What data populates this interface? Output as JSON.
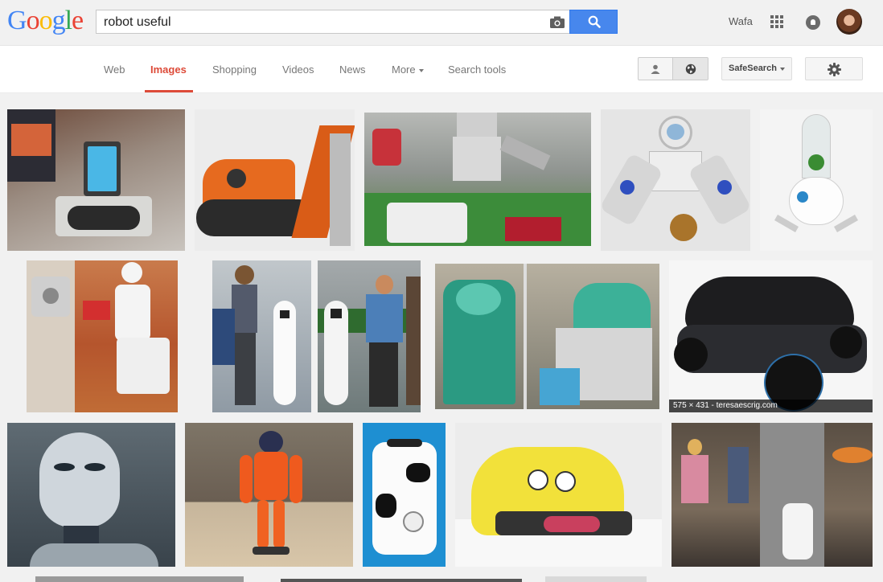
{
  "header": {
    "logo_letters": [
      "G",
      "o",
      "o",
      "g",
      "l",
      "e"
    ],
    "logo_colors": [
      "#4285f4",
      "#ea4335",
      "#fbbc05",
      "#4285f4",
      "#34a853",
      "#ea4335"
    ],
    "query": "robot useful",
    "user_name": "Wafa",
    "icons": {
      "camera": "camera-icon",
      "search": "magnifier-icon",
      "apps": "apps-grid-icon",
      "notifications": "bell-icon",
      "settings": "gear-icon"
    }
  },
  "nav": {
    "tabs": [
      {
        "label": "Web",
        "active": false
      },
      {
        "label": "Images",
        "active": true
      },
      {
        "label": "Shopping",
        "active": false
      },
      {
        "label": "Videos",
        "active": false
      },
      {
        "label": "News",
        "active": false
      },
      {
        "label": "More",
        "active": false
      },
      {
        "label": "Search tools",
        "active": false
      }
    ],
    "safesearch_label": "SafeSearch",
    "accent_color": "#dd4b39"
  },
  "results": {
    "hover_caption": "575 × 431 - teresaescrig.com"
  }
}
